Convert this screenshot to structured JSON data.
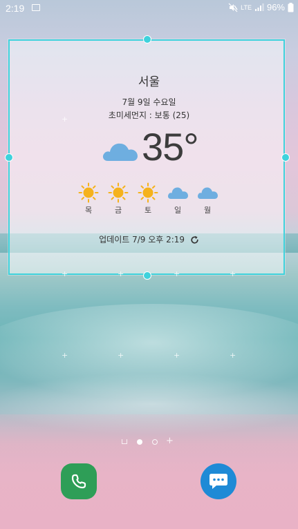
{
  "status_bar": {
    "time": "2:19",
    "network": "LTE",
    "battery_percent": "96%",
    "icons": [
      "gallery-icon",
      "mute-icon",
      "signal-icon",
      "battery-icon"
    ]
  },
  "weather_widget": {
    "city": "서울",
    "date": "7월 9일 수요일",
    "fine_dust": "초미세먼지 : 보통 (25)",
    "temperature": "35°",
    "current_condition_icon": "cloud-icon",
    "forecast": [
      {
        "day": "목",
        "icon": "sun-icon"
      },
      {
        "day": "금",
        "icon": "sun-icon"
      },
      {
        "day": "토",
        "icon": "sun-icon"
      },
      {
        "day": "일",
        "icon": "cloud-icon"
      },
      {
        "day": "월",
        "icon": "cloud-icon"
      }
    ],
    "updated": "업데이트 7/9 오후 2:19",
    "refresh_icon": "refresh-icon"
  },
  "home_screen": {
    "page_count": 3,
    "current_page": 2,
    "dock": [
      {
        "app": "phone",
        "icon": "phone-icon",
        "color": "#2e9e57"
      },
      {
        "app": "messages",
        "icon": "message-icon",
        "color": "#1e8ad6"
      }
    ]
  },
  "colors": {
    "selection_frame": "#3fd2dc",
    "sun": "#f5b21c",
    "cloud": "#6eaee0"
  }
}
